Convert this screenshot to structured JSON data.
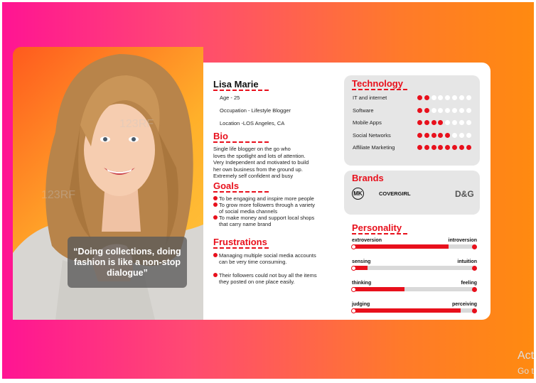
{
  "persona": {
    "name": "Lisa Marie",
    "age": "Age - 25",
    "occupation": "Occupation - Lifestyle Blogger",
    "location": "Location -LOS Angeles, CA"
  },
  "quote": "“Doing collections, doing fashion is like a non-stop dialogue”",
  "bio": {
    "title": "Bio",
    "lines": [
      "Single life blogger on the go who",
      "loves the spotlight and lots of attention.",
      "Very Independent and motivated to build",
      "her own business from the ground up.",
      "Extremely self confident and busy"
    ]
  },
  "goals": {
    "title": "Goals",
    "items": [
      [
        "To be engaging and inspire more people"
      ],
      [
        "To grow more followers through a variety",
        "of social media channels"
      ],
      [
        "To make money and support local shops",
        "that carry name brand"
      ]
    ]
  },
  "frustrations": {
    "title": "Frustrations",
    "items": [
      [
        "Managing multiple social media accounts",
        "can be very time consuming."
      ],
      [
        "Their followers could not buy all the items",
        "they posted on one place easily."
      ]
    ]
  },
  "technology": {
    "title": "Technology",
    "total_dots": 8,
    "items": [
      {
        "label": "IT and internet",
        "level": 2
      },
      {
        "label": "Software",
        "level": 2
      },
      {
        "label": "Mobile Apps",
        "level": 4
      },
      {
        "label": "Social Networks",
        "level": 5
      },
      {
        "label": "Affiliate Marketing",
        "level": 8
      }
    ]
  },
  "brands": {
    "title": "Brands",
    "logo_mk": "MK",
    "covergirl": "COVERGIRL",
    "dg": "D&G"
  },
  "personality": {
    "title": "Personality",
    "traits": [
      {
        "left": "extroversion",
        "right": "introversion",
        "value": 0.78
      },
      {
        "left": "sensing",
        "right": "intuition",
        "value": 0.12
      },
      {
        "left": "thinking",
        "right": "feeling",
        "value": 0.42
      },
      {
        "left": "judging",
        "right": "perceiving",
        "value": 0.88
      }
    ]
  },
  "corner_text": {
    "line1": "Act",
    "line2": "Go t"
  },
  "colors": {
    "accent": "#e8101c",
    "panel": "#e6e6e6",
    "gradient_start": "#ff1493",
    "gradient_end": "#ff8a10"
  },
  "icons": [
    "bullet-dot-icon",
    "michael-kors-logo-icon"
  ]
}
